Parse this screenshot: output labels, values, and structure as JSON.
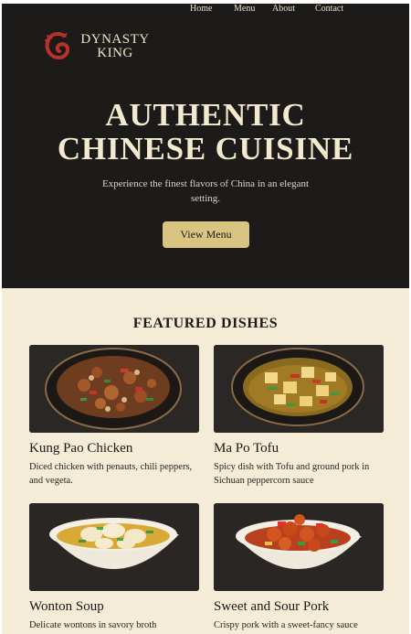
{
  "brand": {
    "line1": "DYNASTY",
    "line2": "KING",
    "logo_icon": "dragon-icon",
    "accent": "#b8322a"
  },
  "nav": {
    "items": [
      "Home",
      "Menu",
      "About",
      "Contact"
    ]
  },
  "hero": {
    "title_line1": "AUTHENTIC",
    "title_line2": "CHINESE CUISINE",
    "subtitle": "Experience the finest flavors of China in an elegant setting.",
    "cta_label": "View Menu"
  },
  "featured": {
    "title": "FEATURED DISHES",
    "dishes": [
      {
        "name": "Kung Pao Chicken",
        "description": "Diced chicken with penauts, chili peppers, and vegeta."
      },
      {
        "name": "Ma Po Tofu",
        "description": "Spicy dish with Tofu and ground pork in Sichuan peppercorn sauce"
      },
      {
        "name": "Wonton Soup",
        "description": "Delicate wontons in savory broth"
      },
      {
        "name": "Sweet and Sour Pork",
        "description": "Crispy pork with a sweet-fancy sauce"
      }
    ]
  },
  "colors": {
    "hero_bg": "#1d1b19",
    "cream": "#f5ecd8",
    "gold_button": "#d9c481"
  }
}
